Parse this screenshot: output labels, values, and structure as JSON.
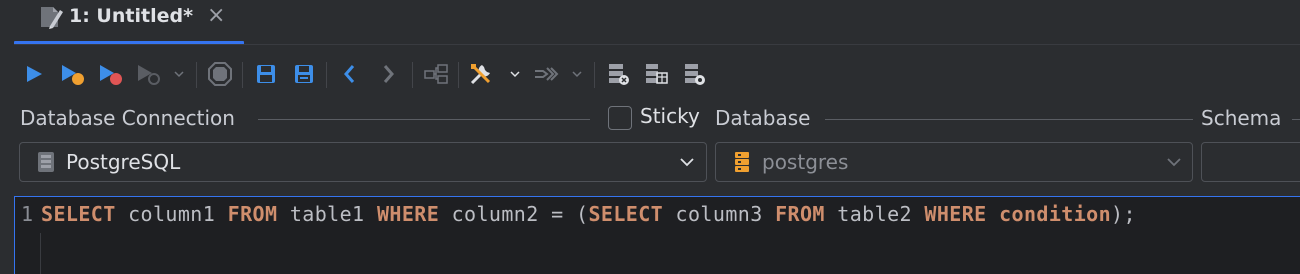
{
  "tab": {
    "title": "1: Untitled*",
    "close": "×"
  },
  "toolbar": {
    "icons": [
      "run-icon",
      "run-to-cursor-icon",
      "debug-icon",
      "profile-icon",
      "stop-icon",
      "save-icon",
      "save-as-icon",
      "back-icon",
      "forward-icon",
      "explain-plan-icon",
      "tools-icon",
      "transaction-icon",
      "db-export-icon",
      "db-import-icon",
      "db-settings-icon"
    ]
  },
  "connection_section": {
    "label": "Database Connection",
    "selected": "PostgreSQL"
  },
  "sticky": {
    "label": "Sticky",
    "checked": false
  },
  "database_section": {
    "label": "Database",
    "selected": "postgres"
  },
  "schema_section": {
    "label": "Schema"
  },
  "editor": {
    "line_number": "1",
    "tokens": [
      {
        "t": "SELECT",
        "k": "kw"
      },
      {
        "t": " column1 ",
        "k": "id"
      },
      {
        "t": "FROM",
        "k": "kw"
      },
      {
        "t": " table1 ",
        "k": "id"
      },
      {
        "t": "WHERE",
        "k": "kw"
      },
      {
        "t": " column2 = (",
        "k": "id"
      },
      {
        "t": "SELECT",
        "k": "kw"
      },
      {
        "t": " column3 ",
        "k": "id"
      },
      {
        "t": "FROM",
        "k": "kw"
      },
      {
        "t": " table2 ",
        "k": "id"
      },
      {
        "t": "WHERE",
        "k": "kw"
      },
      {
        "t": " ",
        "k": "id"
      },
      {
        "t": "condition",
        "k": "kw"
      },
      {
        "t": ");",
        "k": "id"
      }
    ]
  },
  "colors": {
    "accent": "#3574f0",
    "keyword": "#cf8e6d",
    "run_blue": "#3d8ee8",
    "debug_orange": "#f0a030",
    "debug_red": "#e05555"
  }
}
